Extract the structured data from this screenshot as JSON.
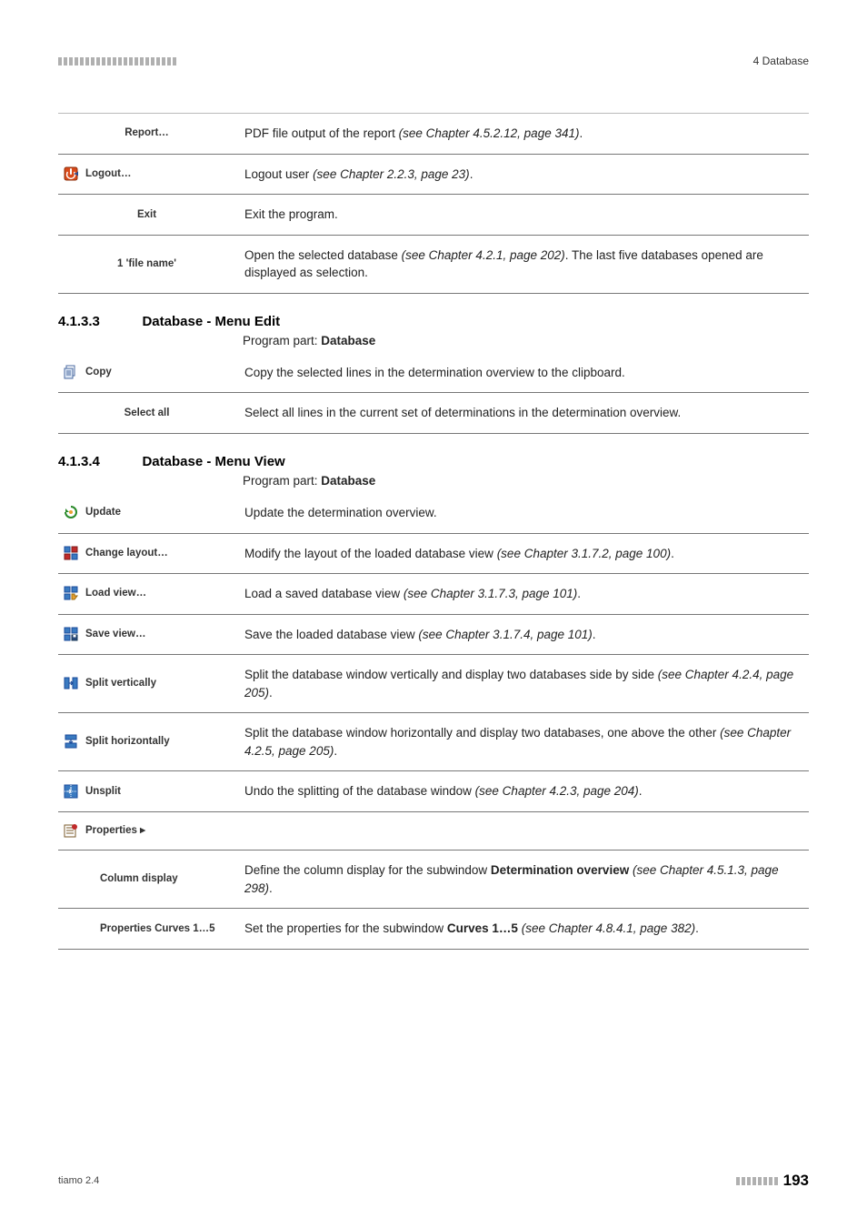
{
  "header": {
    "right": "4 Database"
  },
  "table1": {
    "rows": [
      {
        "icon": null,
        "label": "Report…",
        "label_mode": "center",
        "desc_parts": [
          {
            "t": "PDF file output of the report ",
            "cls": ""
          },
          {
            "t": "(see Chapter 4.5.2.12, page 341)",
            "cls": "italic"
          },
          {
            "t": ".",
            "cls": ""
          }
        ]
      },
      {
        "icon": "logout",
        "label": "Logout…",
        "label_mode": "icon",
        "desc_parts": [
          {
            "t": "Logout user ",
            "cls": ""
          },
          {
            "t": "(see Chapter 2.2.3, page 23)",
            "cls": "italic"
          },
          {
            "t": ".",
            "cls": ""
          }
        ]
      },
      {
        "icon": null,
        "label": "Exit",
        "label_mode": "center",
        "desc_parts": [
          {
            "t": "Exit the program.",
            "cls": ""
          }
        ]
      },
      {
        "icon": null,
        "label": "1 'file name'",
        "label_mode": "center",
        "desc_parts": [
          {
            "t": "Open the selected database ",
            "cls": ""
          },
          {
            "t": "(see Chapter 4.2.1, page 202)",
            "cls": "italic"
          },
          {
            "t": ". The last five databases opened are displayed as selection.",
            "cls": ""
          }
        ]
      }
    ]
  },
  "section_edit": {
    "number": "4.1.3.3",
    "title": "Database - Menu Edit",
    "sub_prefix": "Program part: ",
    "sub_bold": "Database"
  },
  "table2": {
    "rows": [
      {
        "icon": "copy",
        "label": "Copy",
        "label_mode": "icon",
        "desc_parts": [
          {
            "t": "Copy the selected lines in the determination overview to the clipboard.",
            "cls": ""
          }
        ]
      },
      {
        "icon": null,
        "label": "Select all",
        "label_mode": "center",
        "desc_parts": [
          {
            "t": "Select all lines in the current set of determinations in the determination overview.",
            "cls": ""
          }
        ]
      }
    ]
  },
  "section_view": {
    "number": "4.1.3.4",
    "title": "Database - Menu View",
    "sub_prefix": "Program part: ",
    "sub_bold": "Database"
  },
  "table3": {
    "rows": [
      {
        "icon": "update",
        "label": "Update",
        "label_mode": "icon",
        "desc_parts": [
          {
            "t": "Update the determination overview.",
            "cls": ""
          }
        ]
      },
      {
        "icon": "change-layout",
        "label": "Change layout…",
        "label_mode": "icon",
        "desc_parts": [
          {
            "t": "Modify the layout of the loaded database view ",
            "cls": ""
          },
          {
            "t": "(see Chapter 3.1.7.2, page 100)",
            "cls": "italic"
          },
          {
            "t": ".",
            "cls": ""
          }
        ]
      },
      {
        "icon": "load-view",
        "label": "Load view…",
        "label_mode": "icon",
        "desc_parts": [
          {
            "t": "Load a saved database view ",
            "cls": ""
          },
          {
            "t": "(see Chapter 3.1.7.3, page 101)",
            "cls": "italic"
          },
          {
            "t": ".",
            "cls": ""
          }
        ]
      },
      {
        "icon": "save-view",
        "label": "Save view…",
        "label_mode": "icon",
        "desc_parts": [
          {
            "t": "Save the loaded database view ",
            "cls": ""
          },
          {
            "t": "(see Chapter 3.1.7.4, page 101)",
            "cls": "italic"
          },
          {
            "t": ".",
            "cls": ""
          }
        ]
      },
      {
        "icon": "split-vertically",
        "label": "Split vertically",
        "label_mode": "icon",
        "desc_parts": [
          {
            "t": "Split the database window vertically and display two databases side by side ",
            "cls": ""
          },
          {
            "t": "(see Chapter 4.2.4, page 205)",
            "cls": "italic"
          },
          {
            "t": ".",
            "cls": ""
          }
        ]
      },
      {
        "icon": "split-horizontally",
        "label": "Split horizontally",
        "label_mode": "icon",
        "desc_parts": [
          {
            "t": "Split the database window horizontally and display two databases, one above the other ",
            "cls": ""
          },
          {
            "t": "(see Chapter 4.2.5, page 205)",
            "cls": "italic"
          },
          {
            "t": ".",
            "cls": ""
          }
        ]
      },
      {
        "icon": "unsplit",
        "label": "Unsplit",
        "label_mode": "icon",
        "desc_parts": [
          {
            "t": "Undo the splitting of the database window ",
            "cls": ""
          },
          {
            "t": "(see Chapter 4.2.3, page 204)",
            "cls": "italic"
          },
          {
            "t": ".",
            "cls": ""
          }
        ]
      },
      {
        "icon": "properties",
        "label": "Properties ▸",
        "label_mode": "icon",
        "desc_parts": []
      },
      {
        "icon": null,
        "label": "Column display",
        "label_mode": "submenu",
        "desc_parts": [
          {
            "t": "Define the column display for the subwindow ",
            "cls": ""
          },
          {
            "t": "Determination overview",
            "cls": "bold"
          },
          {
            "t": " ",
            "cls": ""
          },
          {
            "t": "(see Chapter 4.5.1.3, page 298)",
            "cls": "italic"
          },
          {
            "t": ".",
            "cls": ""
          }
        ]
      },
      {
        "icon": null,
        "label": "Properties Curves 1…5",
        "label_mode": "submenu",
        "desc_parts": [
          {
            "t": "Set the properties for the subwindow ",
            "cls": ""
          },
          {
            "t": "Curves 1…5",
            "cls": "bold"
          },
          {
            "t": " ",
            "cls": ""
          },
          {
            "t": "(see Chapter 4.8.4.1, page 382)",
            "cls": "italic"
          },
          {
            "t": ".",
            "cls": ""
          }
        ]
      }
    ]
  },
  "footer": {
    "left": "tiamo 2.4",
    "page": "193"
  }
}
